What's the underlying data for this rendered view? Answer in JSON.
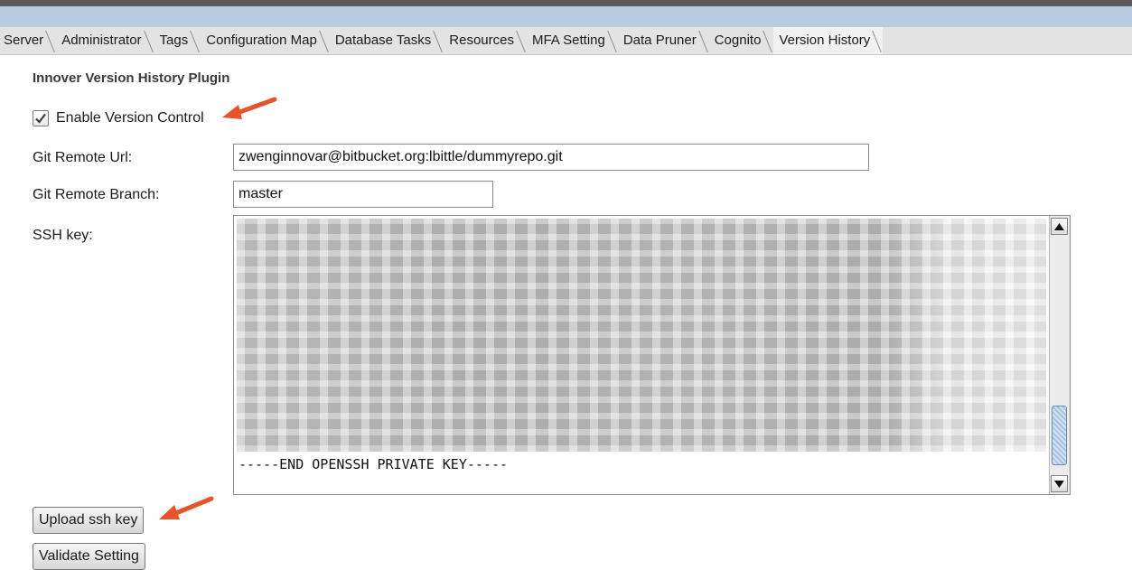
{
  "tabs": [
    {
      "label": "Server",
      "active": false
    },
    {
      "label": "Administrator",
      "active": false
    },
    {
      "label": "Tags",
      "active": false
    },
    {
      "label": "Configuration Map",
      "active": false
    },
    {
      "label": "Database Tasks",
      "active": false
    },
    {
      "label": "Resources",
      "active": false
    },
    {
      "label": "MFA Setting",
      "active": false
    },
    {
      "label": "Data Pruner",
      "active": false
    },
    {
      "label": "Cognito",
      "active": false
    },
    {
      "label": "Version History",
      "active": true
    }
  ],
  "plugin": {
    "title": "Innover Version History Plugin",
    "enable_version_control": {
      "label": "Enable Version Control",
      "checked": true
    },
    "git_remote_url": {
      "label": "Git Remote Url:",
      "value": "zwenginnovar@bitbucket.org:lbittle/dummyrepo.git"
    },
    "git_remote_branch": {
      "label": "Git Remote Branch:",
      "value": "master"
    },
    "ssh_key": {
      "label": "SSH key:",
      "visible_text": "-----END OPENSSH PRIVATE KEY-----"
    },
    "upload_button": "Upload ssh key",
    "validate_button": "Validate Setting"
  },
  "colors": {
    "annotation_arrow": "#e8542a",
    "titlebar": "#b9cbe1",
    "scroll_thumb": "#a7c2dd"
  },
  "icons": [
    "checkmark-icon",
    "scroll-up-arrow-icon",
    "scroll-down-arrow-icon",
    "annotation-arrow-icon"
  ]
}
